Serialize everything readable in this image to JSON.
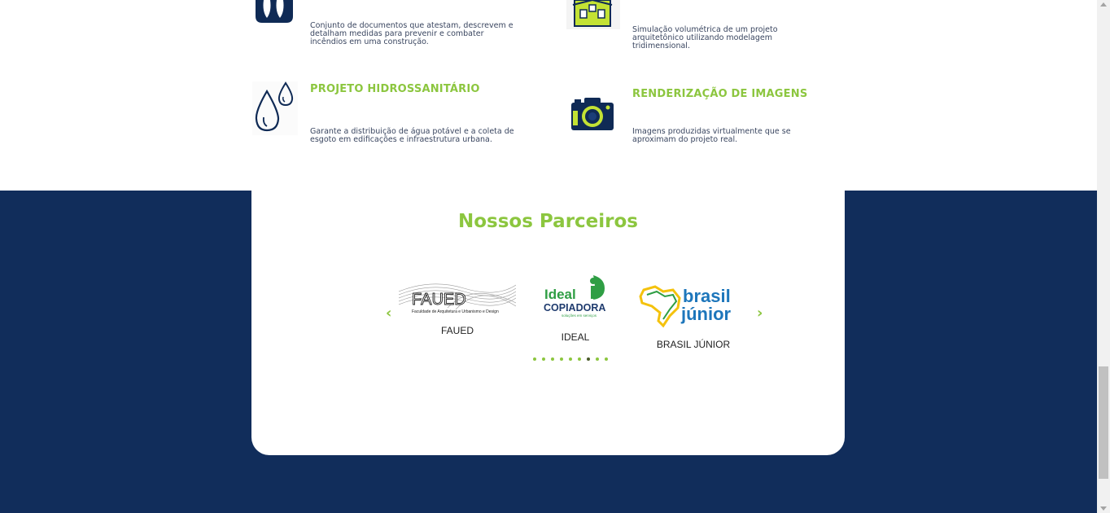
{
  "services": [
    {
      "title": "",
      "description": "Conjunto de documentos que atestam, descrevem e detalham medidas para prevenir e combater incêndios em uma construção.",
      "icon": "fire-drops-icon"
    },
    {
      "title": "",
      "description": "Simulação volumétrica de um projeto arquitetônico utilizando modelagem tridimensional.",
      "icon": "house-model-icon"
    },
    {
      "title": "PROJETO HIDROSSANITÁRIO",
      "description": "Garante a distribuição de água potável e a coleta de esgoto em edificações e infraestrutura urbana.",
      "icon": "water-drops-icon"
    },
    {
      "title": "RENDERIZAÇÃO DE IMAGENS",
      "description": " Imagens produzidas virtualmente que se aproximam do projeto real.",
      "icon": "camera-icon"
    }
  ],
  "partners_section": {
    "title": "Nossos Parceiros",
    "partners": [
      {
        "name": "FAUED",
        "logo_text": "FAUED",
        "logo_subtext": "Faculdade de Arquitetura e Urbanismo e Design"
      },
      {
        "name": "IDEAL",
        "logo_text": "Ideal",
        "logo_text2": "COPIADORA",
        "logo_subtext": "soluções em serviços"
      },
      {
        "name": "BRASIL JÚNIOR",
        "logo_text": "brasil",
        "logo_text2": "júnior"
      }
    ],
    "prev_arrow": "‹",
    "next_arrow": "›",
    "dots_count": 9,
    "active_dot": 6
  },
  "colors": {
    "accent_green": "#8cc63f",
    "navy": "#112d5b",
    "icon_navy": "#0f2a55",
    "brasil_blue": "#1d76bb"
  }
}
